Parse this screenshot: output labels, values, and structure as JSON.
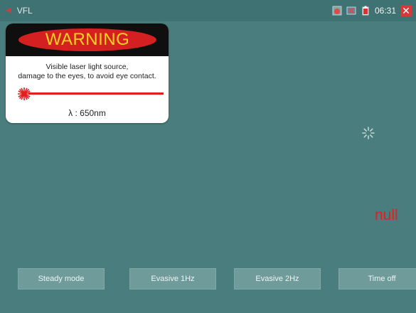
{
  "header": {
    "title": "VFL",
    "clock": "06:31",
    "icons": [
      "back-arrow-icon",
      "alarm-icon",
      "network-off-icon",
      "battery-icon",
      "close-icon"
    ],
    "accent_color": "#d53a3a"
  },
  "warning": {
    "heading": "WARNING",
    "line1": "Visible laser light source,",
    "line2": "damage to the eyes, to avoid eye contact.",
    "wavelength": "λ : 650nm",
    "heading_color": "#ffd21a",
    "oval_color": "#d42020"
  },
  "status": {
    "value": "null",
    "color": "#e02020"
  },
  "buttons": {
    "steady": "Steady mode",
    "evasive1": "Evasive 1Hz",
    "evasive2": "Evasive 2Hz",
    "timeoff": "Time off"
  }
}
